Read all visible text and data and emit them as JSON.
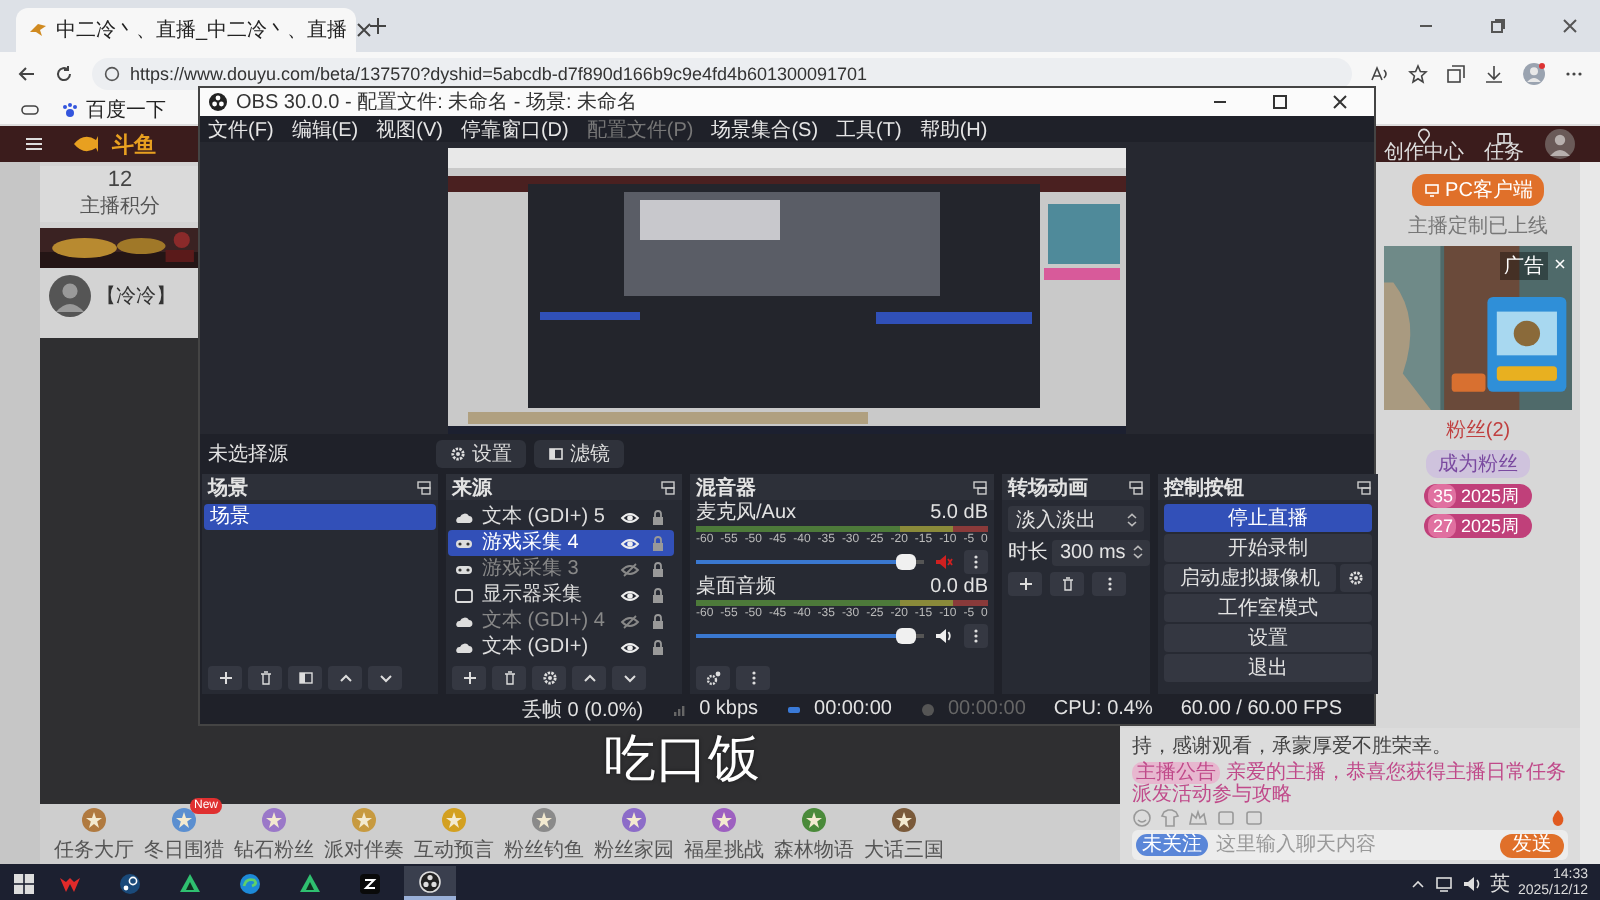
{
  "browser": {
    "tabs": [
      {
        "title": "中二冷丶、直播_中二冷丶、直播",
        "selected": true
      }
    ],
    "url": "https://www.douyu.com/beta/137570?dyshid=5abcdb-d7f890d166b9c9e4fd4b601300091701",
    "bookmarks": [
      "百度一下"
    ]
  },
  "page": {
    "header": {
      "logo": "斗鱼",
      "items": [
        "创作中心",
        "任务"
      ]
    },
    "anchor_card": {
      "score": "12",
      "score_label": "主播积分",
      "name": "【冷冷】"
    },
    "sidebar": {
      "client_button": "PC客户端",
      "client_note": "主播定制已上线",
      "ad_label": "广告",
      "fan_tab": "粉丝(2)",
      "become_fan": "成为粉丝",
      "badges": [
        {
          "rank": "35",
          "label": "2025周"
        },
        {
          "rank": "27",
          "label": "2025周"
        }
      ],
      "announcement_tail": "持，感谢观看，承蒙厚爱不胜荣幸。",
      "notice": {
        "tag": "主播公告",
        "text": "亲爱的主播，恭喜您获得主播日常任务派发活动参与攻略"
      },
      "chat_input": {
        "tag": "未关注",
        "placeholder": "这里输入聊天内容",
        "send": "发送"
      }
    },
    "gifts": [
      {
        "label": "任务大厅"
      },
      {
        "label": "冬日围猎",
        "badge": "New"
      },
      {
        "label": "钻石粉丝"
      },
      {
        "label": "派对伴奏"
      },
      {
        "label": "互动预言"
      },
      {
        "label": "粉丝钓鱼"
      },
      {
        "label": "粉丝家园"
      },
      {
        "label": "福星挑战"
      },
      {
        "label": "森林物语"
      },
      {
        "label": "大话三国"
      }
    ]
  },
  "obs": {
    "title": "OBS 30.0.0 - 配置文件: 未命名 - 场景: 未命名",
    "menu": [
      {
        "label": "文件(F)",
        "disabled": false
      },
      {
        "label": "编辑(E)",
        "disabled": false
      },
      {
        "label": "视图(V)",
        "disabled": false
      },
      {
        "label": "停靠窗口(D)",
        "disabled": false
      },
      {
        "label": "配置文件(P)",
        "disabled": true
      },
      {
        "label": "场景集合(S)",
        "disabled": false
      },
      {
        "label": "工具(T)",
        "disabled": false
      },
      {
        "label": "帮助(H)",
        "disabled": false
      }
    ],
    "toolbar": {
      "status": "未选择源",
      "buttons": [
        {
          "kind": "properties",
          "label": "设置"
        },
        {
          "kind": "filters",
          "label": "滤镜"
        }
      ]
    },
    "scenes": {
      "title": "场景",
      "items": [
        {
          "name": "场景",
          "selected": true
        }
      ]
    },
    "sources": {
      "title": "来源",
      "items": [
        {
          "kind": "text",
          "name": "文本 (GDI+) 5",
          "visible": true,
          "selected": false
        },
        {
          "kind": "game",
          "name": "游戏采集 4",
          "visible": true,
          "selected": true
        },
        {
          "kind": "game",
          "name": "游戏采集 3",
          "visible": false,
          "selected": false
        },
        {
          "kind": "display",
          "name": "显示器采集",
          "visible": true,
          "selected": false
        },
        {
          "kind": "text",
          "name": "文本 (GDI+) 4",
          "visible": false,
          "selected": false
        },
        {
          "kind": "text",
          "name": "文本 (GDI+)",
          "visible": true,
          "selected": false
        }
      ]
    },
    "mixer": {
      "title": "混音器",
      "channels": [
        {
          "name": "麦克风/Aux",
          "reading": "5.0 dB",
          "muted": true,
          "level": 0.92,
          "scale": [
            "-60",
            "-55",
            "-50",
            "-45",
            "-40",
            "-35",
            "-30",
            "-25",
            "-20",
            "-15",
            "-10",
            "-5",
            "0"
          ]
        },
        {
          "name": "桌面音频",
          "reading": "0.0 dB",
          "muted": false,
          "level": 0.92,
          "scale": [
            "-60",
            "-55",
            "-50",
            "-45",
            "-40",
            "-35",
            "-30",
            "-25",
            "-20",
            "-15",
            "-10",
            "-5",
            "0"
          ]
        }
      ]
    },
    "transitions": {
      "title": "转场动画",
      "selected": "淡入淡出",
      "duration_label": "时长",
      "duration": "300 ms"
    },
    "controls": {
      "title": "控制按钮",
      "buttons": [
        {
          "kind": "plain",
          "label": "停止直播",
          "active": true
        },
        {
          "kind": "plain",
          "label": "开始录制",
          "active": false
        },
        {
          "kind": "with_settings",
          "label": "启动虚拟摄像机",
          "active": false
        },
        {
          "kind": "plain",
          "label": "工作室模式",
          "active": false
        },
        {
          "kind": "plain",
          "label": "设置",
          "active": false
        },
        {
          "kind": "plain",
          "label": "退出",
          "active": false
        }
      ]
    },
    "status": {
      "dropped": "丢帧 0 (0.0%)",
      "bitrate": "0 kbps",
      "stream_time": "00:00:00",
      "streaming": true,
      "record_time": "00:00:00",
      "recording": false,
      "cpu": "CPU: 0.4%",
      "fps": "60.00 / 60.00 FPS"
    }
  },
  "overlay_text": "吃口饭",
  "taskbar": {
    "apps": [
      {
        "kind": "chevron",
        "active": false
      },
      {
        "kind": "steam",
        "active": false
      },
      {
        "kind": "triangle",
        "active": false
      },
      {
        "kind": "swirl",
        "active": false
      },
      {
        "kind": "triangle",
        "active": false
      },
      {
        "kind": "zigzag",
        "active": false
      },
      {
        "kind": "obs",
        "active": true
      }
    ],
    "ime": "英",
    "time": "14:33",
    "date": "2025/12/12"
  }
}
